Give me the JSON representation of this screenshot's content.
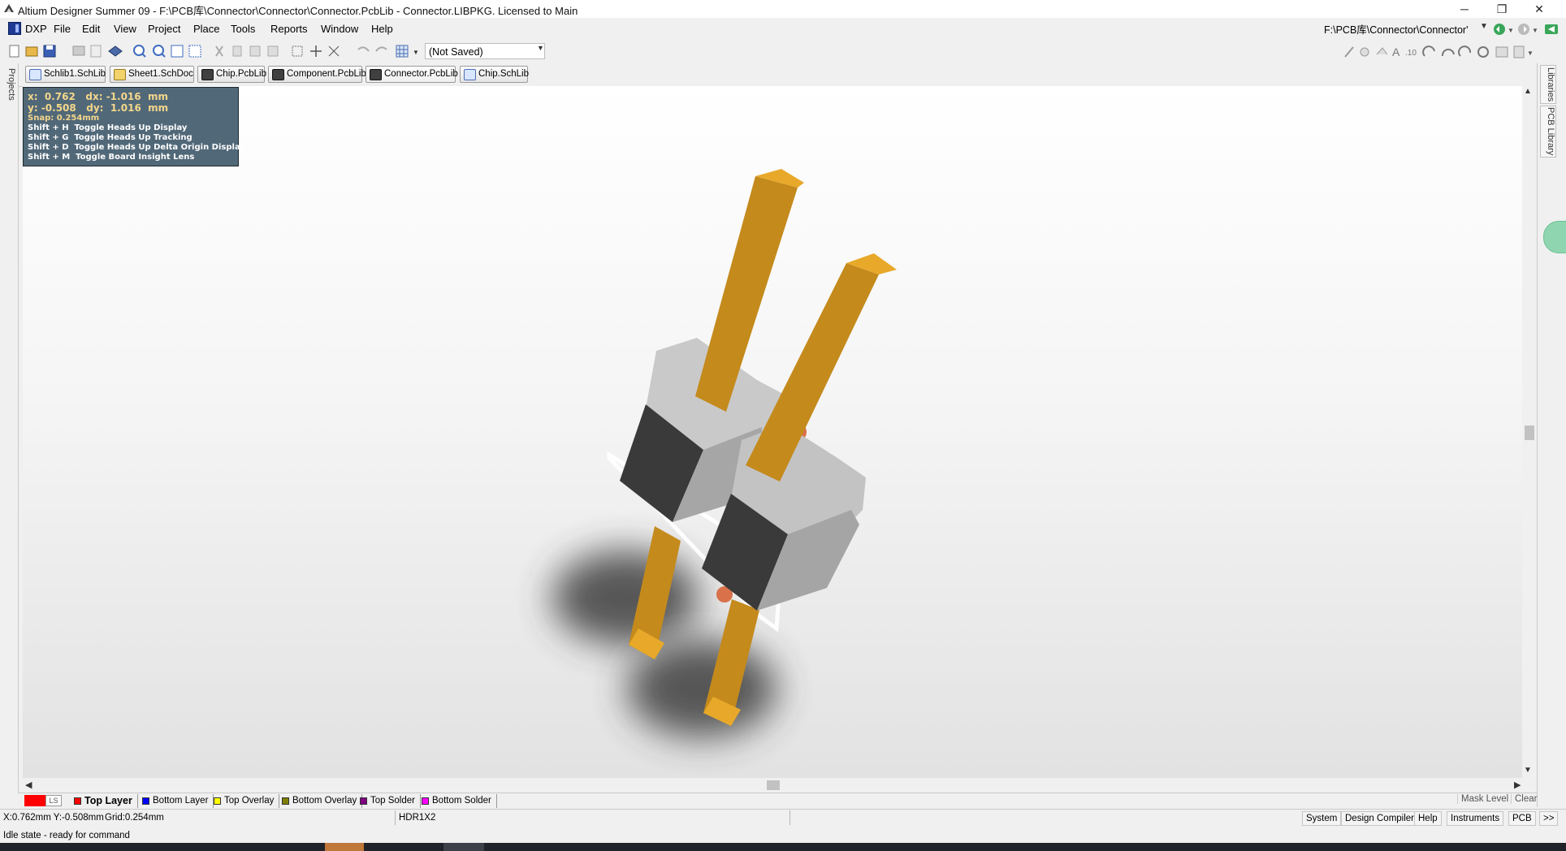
{
  "window": {
    "title": "Altium Designer Summer 09 - F:\\PCB库\\Connector\\Connector\\Connector.PcbLib - Connector.LIBPKG. Licensed to Main",
    "minimize_glyph": "─",
    "maximize_glyph": "❐",
    "close_glyph": "✕"
  },
  "menu": {
    "items": [
      "DXP",
      "File",
      "Edit",
      "View",
      "Project",
      "Place",
      "Tools",
      "Reports",
      "Window",
      "Help"
    ],
    "path": "F:\\PCB库\\Connector\\Connector'"
  },
  "toolbar": {
    "view_config": "(Not Saved)"
  },
  "tabs": [
    {
      "label": "Schlib1.SchLib",
      "icon": "schlib-icon"
    },
    {
      "label": "Sheet1.SchDoc",
      "icon": "schdoc-icon"
    },
    {
      "label": "Chip.PcbLib",
      "icon": "pcblib-icon"
    },
    {
      "label": "Component.PcbLib",
      "icon": "pcblib-icon"
    },
    {
      "label": "Connector.PcbLib",
      "icon": "pcblib-icon"
    },
    {
      "label": "Chip.SchLib",
      "icon": "schlib-icon"
    }
  ],
  "side_panels": {
    "left": "Projects",
    "right": [
      "Libraries",
      "PCB Library"
    ]
  },
  "hud": {
    "line1": "x:  0.762   dx: -1.016  mm",
    "line2": "y: -0.508   dy:  1.016  mm",
    "snap": "Snap: 0.254mm",
    "shortcuts": [
      "Shift + H  Toggle Heads Up Display",
      "Shift + G  Toggle Heads Up Tracking",
      "Shift + D  Toggle Heads Up Delta Origin Display",
      "Shift + M  Toggle Board Insight Lens"
    ]
  },
  "layers": {
    "ls_label": "LS",
    "items": [
      {
        "label": "Top Layer",
        "color": "#ff0000",
        "active": true
      },
      {
        "label": "Bottom Layer",
        "color": "#0000ff",
        "active": false
      },
      {
        "label": "Top Overlay",
        "color": "#ffff00",
        "active": false
      },
      {
        "label": "Bottom Overlay",
        "color": "#808000",
        "active": false
      },
      {
        "label": "Top Solder",
        "color": "#800080",
        "active": false
      },
      {
        "label": "Bottom Solder",
        "color": "#ff00ff",
        "active": false
      }
    ],
    "mask_level": "Mask Level",
    "clear": "Clear"
  },
  "status": {
    "coords": "X:0.762mm Y:-0.508mm",
    "grid": "Grid:0.254mm",
    "component": "HDR1X2",
    "state": "Idle state - ready for command",
    "panels": [
      "System",
      "Design Compiler",
      "Help",
      "Instruments",
      "PCB"
    ],
    "more": ">>"
  },
  "colors": {
    "pin": "#c48a1c",
    "pin_top": "#e8a92a",
    "body_dark": "#383838",
    "body_light": "#bfbfbf",
    "hud_bg": "#465f70",
    "hud_accent": "#f4d78c"
  }
}
